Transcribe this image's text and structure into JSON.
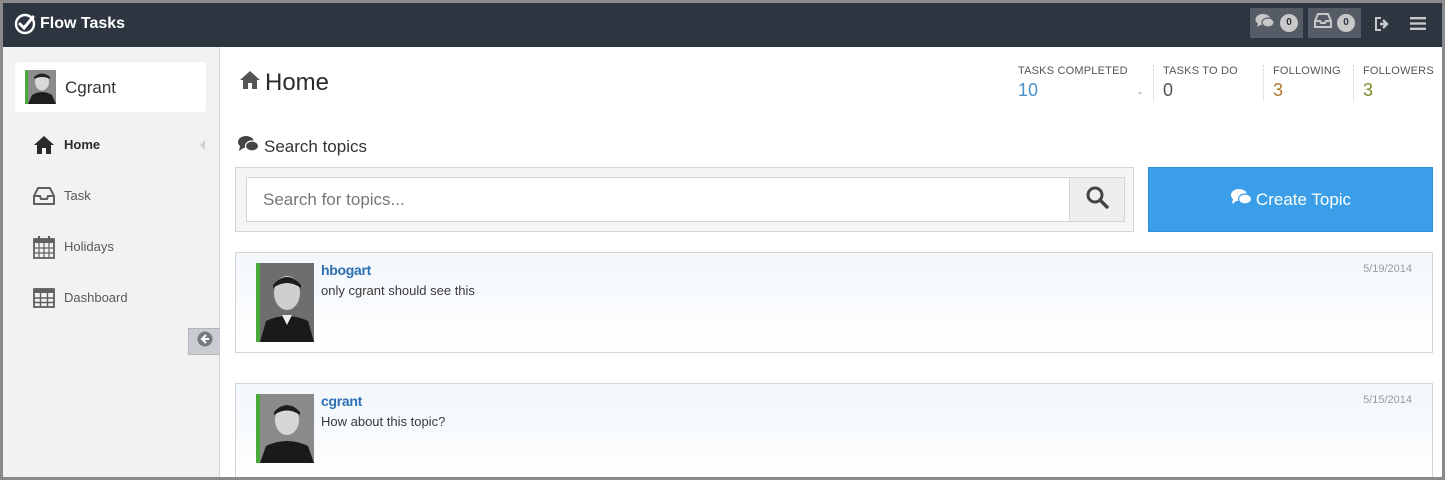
{
  "app": {
    "title": "Flow Tasks"
  },
  "navbar": {
    "messages_count": "0",
    "inbox_count": "0"
  },
  "sidebar": {
    "user": {
      "name": "Cgrant"
    },
    "items": [
      {
        "label": "Home",
        "icon": "home-icon",
        "active": true
      },
      {
        "label": "Task",
        "icon": "inbox-icon",
        "active": false
      },
      {
        "label": "Holidays",
        "icon": "calendar-icon",
        "active": false
      },
      {
        "label": "Dashboard",
        "icon": "table-icon",
        "active": false
      }
    ]
  },
  "main": {
    "page_title": "Home",
    "stats": [
      {
        "label": "TASKS COMPLETED",
        "value": "10",
        "color": "#4a90c8"
      },
      {
        "label": "TASKS TO DO",
        "value": "0",
        "color": "#555555"
      },
      {
        "label": "FOLLOWING",
        "value": "3",
        "color": "#b0792f"
      },
      {
        "label": "FOLLOWERS",
        "value": "3",
        "color": "#7a8c2f"
      }
    ],
    "stats_dash": "-",
    "search_heading": "Search topics",
    "search_placeholder": "Search for topics...",
    "create_topic_label": "Create Topic",
    "topics": [
      {
        "user": "hbogart",
        "text": "only cgrant should see this",
        "date": "5/19/2014"
      },
      {
        "user": "cgrant",
        "text": "How about this topic?",
        "date": "5/15/2014"
      }
    ]
  },
  "colors": {
    "navbar_bg": "#2c3540",
    "accent_blue": "#3a9ee8",
    "avatar_border": "#4caa3c",
    "username_link": "#2d6fb3"
  }
}
